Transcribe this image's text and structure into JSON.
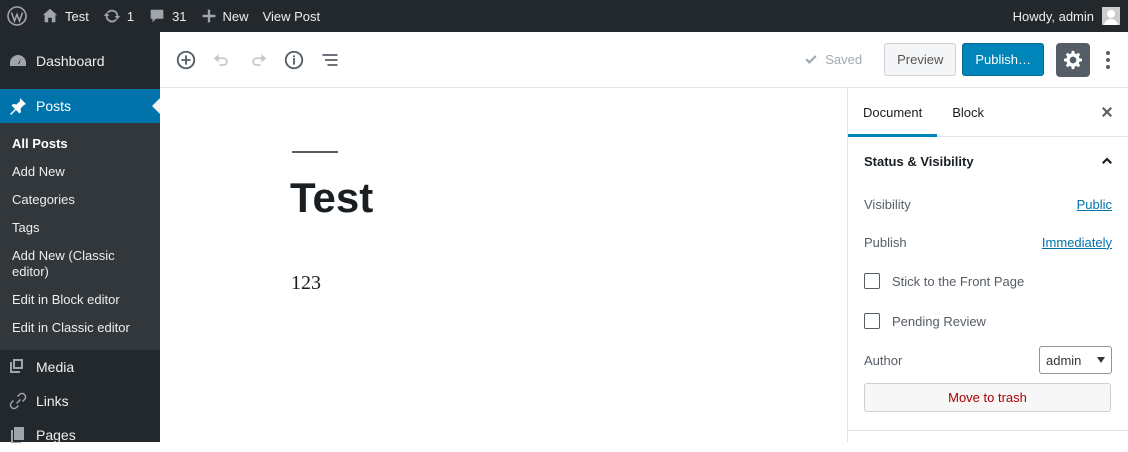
{
  "adminbar": {
    "site_name": "Test",
    "updates_count": "1",
    "comments_count": "31",
    "new_label": "New",
    "view_post_label": "View Post",
    "howdy": "Howdy, admin"
  },
  "menu": {
    "dashboard": "Dashboard",
    "posts": "Posts",
    "posts_sub": [
      "All Posts",
      "Add New",
      "Categories",
      "Tags",
      "Add New (Classic editor)",
      "Edit in Block editor",
      "Edit in Classic editor"
    ],
    "media": "Media",
    "links": "Links",
    "pages": "Pages"
  },
  "toolbar": {
    "saved_label": "Saved",
    "preview_label": "Preview",
    "publish_label": "Publish…"
  },
  "post": {
    "title": "Test",
    "body": "123"
  },
  "sidebar": {
    "tab_document": "Document",
    "tab_block": "Block",
    "panel_title": "Status & Visibility",
    "visibility_label": "Visibility",
    "visibility_value": "Public",
    "publish_label": "Publish",
    "publish_value": "Immediately",
    "sticky_label": "Stick to the Front Page",
    "pending_label": "Pending Review",
    "author_label": "Author",
    "author_value": "admin",
    "trash_label": "Move to trash"
  },
  "colors": {
    "adminbar_bg": "#23282d",
    "menu_current": "#0073aa",
    "publish_button": "#0085ba",
    "trash_text": "#aa0000"
  }
}
